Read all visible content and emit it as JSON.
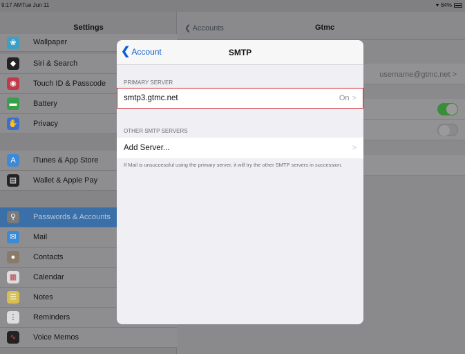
{
  "status": {
    "time": "9:17 AM",
    "date": "Tue Jun 11",
    "battery": "84%"
  },
  "sidebar": {
    "title": "Settings",
    "items": [
      {
        "label": "Wallpaper",
        "icon": "wallpaper-icon",
        "color": "#3aa0c8"
      },
      {
        "label": "Siri & Search",
        "icon": "siri-icon",
        "color": "#222"
      },
      {
        "label": "Touch ID & Passcode",
        "icon": "fingerprint-icon",
        "color": "#c23a48"
      },
      {
        "label": "Battery",
        "icon": "battery-icon",
        "color": "#3a9e4a"
      },
      {
        "label": "Privacy",
        "icon": "hand-icon",
        "color": "#3a6fd0"
      },
      {
        "label": "iTunes & App Store",
        "icon": "app-store-icon",
        "color": "#3a8ad8"
      },
      {
        "label": "Wallet & Apple Pay",
        "icon": "wallet-icon",
        "color": "#222"
      },
      {
        "label": "Passwords & Accounts",
        "icon": "key-icon",
        "color": "#7a7a7a",
        "selected": true
      },
      {
        "label": "Mail",
        "icon": "mail-icon",
        "color": "#3a8ad8"
      },
      {
        "label": "Contacts",
        "icon": "contacts-icon",
        "color": "#8a7a6a"
      },
      {
        "label": "Calendar",
        "icon": "calendar-icon",
        "color": "#ddd"
      },
      {
        "label": "Notes",
        "icon": "notes-icon",
        "color": "#d8c050"
      },
      {
        "label": "Reminders",
        "icon": "reminders-icon",
        "color": "#ddd"
      },
      {
        "label": "Voice Memos",
        "icon": "voice-memos-icon",
        "color": "#222"
      }
    ]
  },
  "pane": {
    "back": "Accounts",
    "title": "Gtmc",
    "username": "username@gtmc.net >"
  },
  "modal": {
    "back": "Account",
    "title": "SMTP",
    "primary_header": "PRIMARY SERVER",
    "primary_server": "smtp3.gtmc.net",
    "primary_status": "On",
    "other_header": "OTHER SMTP SERVERS",
    "add_server": "Add Server...",
    "note": "If Mail is unsuccessful using the primary server, it will try the other SMTP servers in succession.",
    "accent": "#0a60d0",
    "highlight_color": "#d0202a"
  }
}
